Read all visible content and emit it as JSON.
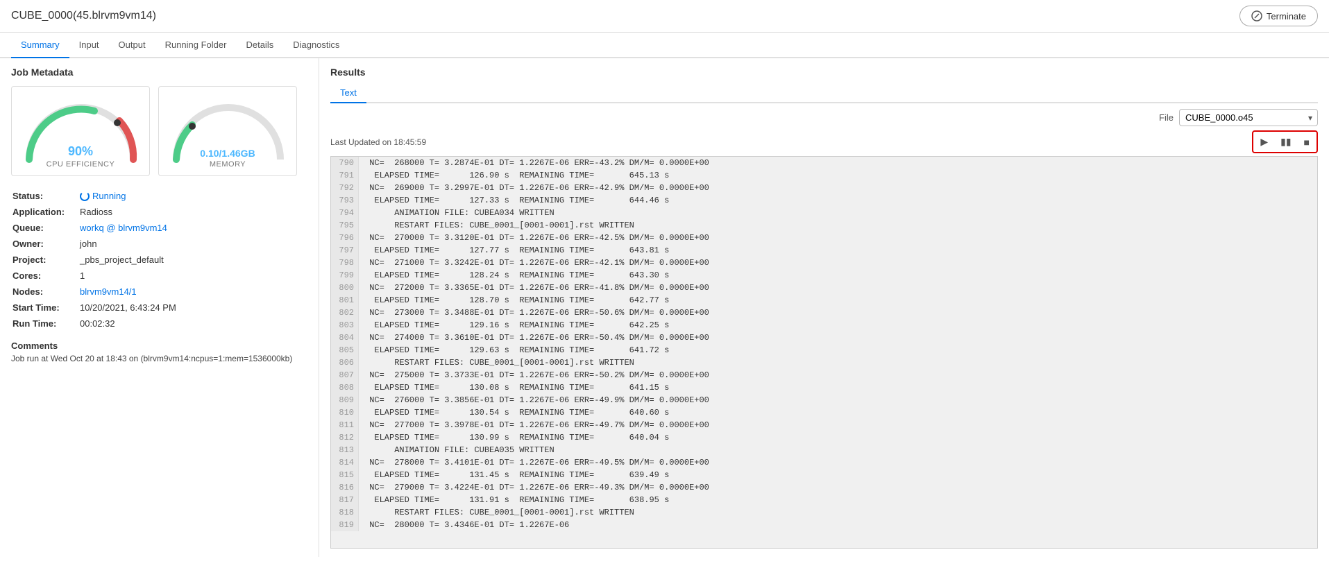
{
  "header": {
    "title": "CUBE_0000(45.blrvm9vm14)",
    "terminate_label": "Terminate"
  },
  "nav": {
    "tabs": [
      {
        "id": "summary",
        "label": "Summary",
        "active": true
      },
      {
        "id": "input",
        "label": "Input",
        "active": false
      },
      {
        "id": "output",
        "label": "Output",
        "active": false
      },
      {
        "id": "running-folder",
        "label": "Running Folder",
        "active": false
      },
      {
        "id": "details",
        "label": "Details",
        "active": false
      },
      {
        "id": "diagnostics",
        "label": "Diagnostics",
        "active": false
      }
    ]
  },
  "left": {
    "job_metadata_title": "Job Metadata",
    "gauge_cpu": {
      "value": "90%",
      "label": "CPU EFFICIENCY"
    },
    "gauge_mem": {
      "value": "0.10/1.46GB",
      "label": "MEMORY"
    },
    "metadata": [
      {
        "key": "Status:",
        "value": "Running",
        "type": "status"
      },
      {
        "key": "Application:",
        "value": "Radioss"
      },
      {
        "key": "Queue:",
        "value": "workq @ blrvm9vm14",
        "type": "link"
      },
      {
        "key": "Owner:",
        "value": "john"
      },
      {
        "key": "Project:",
        "value": "_pbs_project_default"
      },
      {
        "key": "Cores:",
        "value": "1"
      },
      {
        "key": "Nodes:",
        "value": "blrvm9vm14/1",
        "type": "link"
      },
      {
        "key": "Start Time:",
        "value": "10/20/2021, 6:43:24 PM"
      },
      {
        "key": "Run Time:",
        "value": "00:02:32"
      }
    ],
    "comments_title": "Comments",
    "comments_text": "Job run at Wed Oct 20 at 18:43 on (blrvm9vm14:ncpus=1:mem=1536000kb)"
  },
  "right": {
    "results_title": "Results",
    "tabs": [
      {
        "id": "text",
        "label": "Text",
        "active": true
      }
    ],
    "file_label": "File",
    "file_options": [
      "CUBE_0000.o45"
    ],
    "file_selected": "CUBE_0000.o45",
    "last_updated": "Last Updated on 18:45:59",
    "output_lines": [
      {
        "num": "790",
        "content": " NC=  268000 T= 3.2874E-01 DT= 1.2267E-06 ERR=-43.2% DM/M= 0.0000E+00"
      },
      {
        "num": "791",
        "content": "  ELAPSED TIME=      126.90 s  REMAINING TIME=       645.13 s"
      },
      {
        "num": "792",
        "content": " NC=  269000 T= 3.2997E-01 DT= 1.2267E-06 ERR=-42.9% DM/M= 0.0000E+00"
      },
      {
        "num": "793",
        "content": "  ELAPSED TIME=      127.33 s  REMAINING TIME=       644.46 s"
      },
      {
        "num": "794",
        "content": "      ANIMATION FILE: CUBEA034 WRITTEN"
      },
      {
        "num": "795",
        "content": "      RESTART FILES: CUBE_0001_[0001-0001].rst WRITTEN"
      },
      {
        "num": "796",
        "content": " NC=  270000 T= 3.3120E-01 DT= 1.2267E-06 ERR=-42.5% DM/M= 0.0000E+00"
      },
      {
        "num": "797",
        "content": "  ELAPSED TIME=      127.77 s  REMAINING TIME=       643.81 s"
      },
      {
        "num": "798",
        "content": " NC=  271000 T= 3.3242E-01 DT= 1.2267E-06 ERR=-42.1% DM/M= 0.0000E+00"
      },
      {
        "num": "799",
        "content": "  ELAPSED TIME=      128.24 s  REMAINING TIME=       643.30 s"
      },
      {
        "num": "800",
        "content": " NC=  272000 T= 3.3365E-01 DT= 1.2267E-06 ERR=-41.8% DM/M= 0.0000E+00"
      },
      {
        "num": "801",
        "content": "  ELAPSED TIME=      128.70 s  REMAINING TIME=       642.77 s"
      },
      {
        "num": "802",
        "content": " NC=  273000 T= 3.3488E-01 DT= 1.2267E-06 ERR=-50.6% DM/M= 0.0000E+00"
      },
      {
        "num": "803",
        "content": "  ELAPSED TIME=      129.16 s  REMAINING TIME=       642.25 s"
      },
      {
        "num": "804",
        "content": " NC=  274000 T= 3.3610E-01 DT= 1.2267E-06 ERR=-50.4% DM/M= 0.0000E+00"
      },
      {
        "num": "805",
        "content": "  ELAPSED TIME=      129.63 s  REMAINING TIME=       641.72 s"
      },
      {
        "num": "806",
        "content": "      RESTART FILES: CUBE_0001_[0001-0001].rst WRITTEN"
      },
      {
        "num": "807",
        "content": " NC=  275000 T= 3.3733E-01 DT= 1.2267E-06 ERR=-50.2% DM/M= 0.0000E+00"
      },
      {
        "num": "808",
        "content": "  ELAPSED TIME=      130.08 s  REMAINING TIME=       641.15 s"
      },
      {
        "num": "809",
        "content": " NC=  276000 T= 3.3856E-01 DT= 1.2267E-06 ERR=-49.9% DM/M= 0.0000E+00"
      },
      {
        "num": "810",
        "content": "  ELAPSED TIME=      130.54 s  REMAINING TIME=       640.60 s"
      },
      {
        "num": "811",
        "content": " NC=  277000 T= 3.3978E-01 DT= 1.2267E-06 ERR=-49.7% DM/M= 0.0000E+00"
      },
      {
        "num": "812",
        "content": "  ELAPSED TIME=      130.99 s  REMAINING TIME=       640.04 s"
      },
      {
        "num": "813",
        "content": "      ANIMATION FILE: CUBEA035 WRITTEN"
      },
      {
        "num": "814",
        "content": " NC=  278000 T= 3.4101E-01 DT= 1.2267E-06 ERR=-49.5% DM/M= 0.0000E+00"
      },
      {
        "num": "815",
        "content": "  ELAPSED TIME=      131.45 s  REMAINING TIME=       639.49 s"
      },
      {
        "num": "816",
        "content": " NC=  279000 T= 3.4224E-01 DT= 1.2267E-06 ERR=-49.3% DM/M= 0.0000E+00"
      },
      {
        "num": "817",
        "content": "  ELAPSED TIME=      131.91 s  REMAINING TIME=       638.95 s"
      },
      {
        "num": "818",
        "content": "      RESTART FILES: CUBE_0001_[0001-0001].rst WRITTEN"
      },
      {
        "num": "819",
        "content": " NC=  280000 T= 3.4346E-01 DT= 1.2267E-06"
      }
    ]
  }
}
